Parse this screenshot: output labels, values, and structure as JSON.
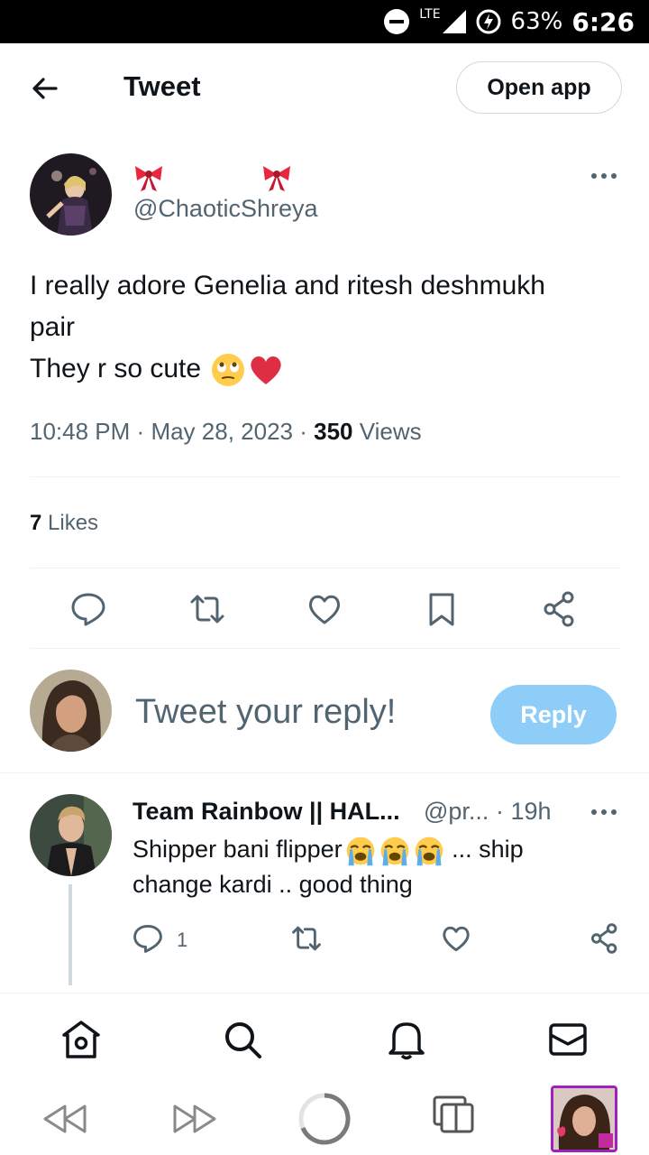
{
  "status_bar": {
    "network": "LTE",
    "battery": "63%",
    "time": "6:26"
  },
  "header": {
    "title": "Tweet",
    "open_app_label": "Open app"
  },
  "tweet": {
    "handle": "@ChaoticShreya",
    "text_lines": [
      "I really adore Genelia and ritesh deshmukh",
      "pair",
      "They r so cute"
    ],
    "time": "10:48 PM",
    "date": "May 28, 2023",
    "separator": "·",
    "views_count": "350",
    "views_label": "Views",
    "likes_count": "7",
    "likes_label": "Likes"
  },
  "composer": {
    "placeholder": "Tweet your reply!",
    "reply_label": "Reply"
  },
  "reply": {
    "name": "Team Rainbow || HAL...",
    "handle": "@pr...",
    "age": "· 19h",
    "text_line1": "Shipper bani flipper",
    "text_line1_suffix": " ... ship",
    "text_line2": "change kardi  .. good thing",
    "reply_count": "1"
  },
  "colors": {
    "accent_light": "#8ecdf8",
    "secondary_text": "#536471",
    "heart": "#e0245e"
  }
}
